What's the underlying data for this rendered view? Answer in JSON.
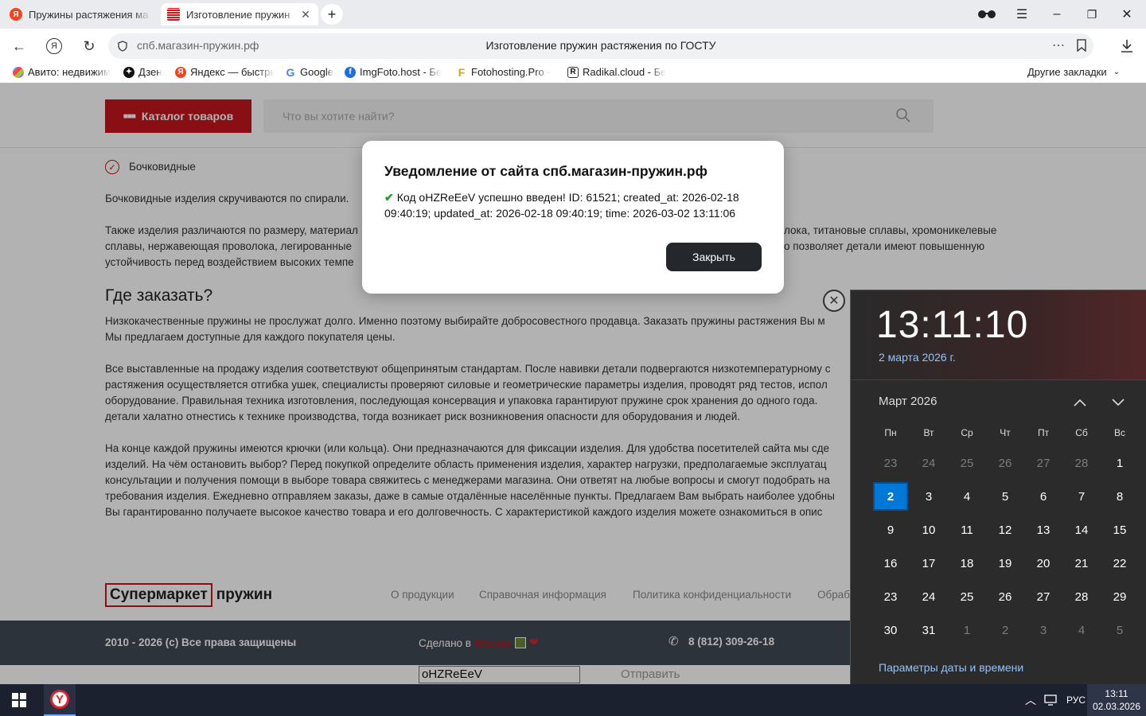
{
  "browser": {
    "tabs": [
      {
        "title": "Пружины растяжения ма",
        "active": false
      },
      {
        "title": "Изготовление пружин",
        "active": true
      }
    ],
    "url": "спб.магазин-пружин.рф",
    "page_title": "Изготовление пружин растяжения по ГОСТУ",
    "bookmarks": [
      "Авито: недвижим",
      "Дзен",
      "Яндекс — быстры",
      "Google",
      "ImgFoto.host - Бе",
      "Fotohosting.Pro -",
      "Radikal.cloud - Бе"
    ],
    "other_bookmarks": "Другие закладки"
  },
  "site": {
    "catalog_button": "Каталог товаров",
    "search_placeholder": "Что вы хотите найти?",
    "check_item": "Бочковидные",
    "p1": "Бочковидные изделия скручиваются по спирали.",
    "p2_lines": [
      "Также изделия различаются по размеру, материал",
      "сплавы, нержавеющая проволока, легированные",
      "устойчивость перед воздействием высоких темпе"
    ],
    "p2_right": [
      "лока, титановые сплавы, хромоникелевые",
      "о позволяет детали имеют повышенную"
    ],
    "h2": "Где заказать?",
    "p3_lines": [
      "Низкокачественные пружины не прослужат долго. Именно поэтому выбирайте добросовестного продавца. Заказать пружины растяжения Вы м",
      "Мы предлагаем доступные для каждого покупателя цены."
    ],
    "p4_lines": [
      "Все выставленные на продажу изделия соответствуют общепринятым стандартам. После навивки детали подвергаются низкотемпературному с",
      "растяжения осуществляется отгибка ушек, специалисты проверяют силовые и геометрические параметры изделия, проводят ряд тестов, испол",
      "оборудование. Правильная техника изготовления, последующая консервация и упаковка гарантируют пружине срок хранения до одного года.",
      "детали халатно отнестись к технике производства, тогда возникает риск возникновения опасности для оборудования и людей."
    ],
    "p5_lines": [
      "На конце каждой пружины имеются крючки (или кольца). Они предназначаются для фиксации изделия. Для удобства посетителей сайта мы сде",
      "изделий. На чём остановить выбор? Перед покупкой определите область применения изделия, характер нагрузки, предполагаемые эксплуатац",
      "консультации и получения помощи в выборе товара свяжитесь с менеджерами магазина. Они ответят на любые вопросы и смогут подобрать на",
      "требования изделия. Ежедневно отправляем заказы, даже в самые отдалённые населённые пункты. Предлагаем Вам выбрать наиболее удобны",
      "Вы гарантированно получаете высокое качество товара и его долговечность. С характеристикой каждого изделия можете ознакомиться в опис"
    ],
    "logo_boxed": "Супермаркет",
    "logo_rest": "пружин",
    "footer_links": [
      "О продукции",
      "Справочная информация",
      "Политика конфиденциальности",
      "Обраб"
    ],
    "copyright": "2010 - 2026 (с) Все права защищены",
    "made_in": "Сделано в",
    "made_in_word": "Москве",
    "phone": "8 (812) 309-26-18",
    "code_input_value": "oHZReEeV",
    "send_button": "Отправить"
  },
  "dialog": {
    "title": "Уведомление от сайта спб.магазин-пружин.рф",
    "message": "Код oHZReEeV успешно введен! ID: 61521; created_at: 2026-02-18 09:40:19; updated_at: 2026-02-18 09:40:19; time: 2026-03-02 13:11:06",
    "close_button": "Закрыть"
  },
  "calendar": {
    "time": "13:11:10",
    "date_long": "2 марта 2026 г.",
    "month_label": "Март 2026",
    "weekdays": [
      "Пн",
      "Вт",
      "Ср",
      "Чт",
      "Пт",
      "Сб",
      "Вс"
    ],
    "weeks": [
      [
        "23",
        "24",
        "25",
        "26",
        "27",
        "28",
        "1"
      ],
      [
        "2",
        "3",
        "4",
        "5",
        "6",
        "7",
        "8"
      ],
      [
        "9",
        "10",
        "11",
        "12",
        "13",
        "14",
        "15"
      ],
      [
        "16",
        "17",
        "18",
        "19",
        "20",
        "21",
        "22"
      ],
      [
        "23",
        "24",
        "25",
        "26",
        "27",
        "28",
        "29"
      ],
      [
        "30",
        "31",
        "1",
        "2",
        "3",
        "4",
        "5"
      ]
    ],
    "dim_first_row_count": 6,
    "dim_last_row_from": 2,
    "today": "2",
    "settings_link": "Параметры даты и времени"
  },
  "taskbar": {
    "language": "РУС",
    "time": "13:11",
    "date": "02.03.2026"
  },
  "colors": {
    "brand_red": "#c5161d",
    "footer_dark": "#414953",
    "accent_blue": "#0078d7"
  }
}
